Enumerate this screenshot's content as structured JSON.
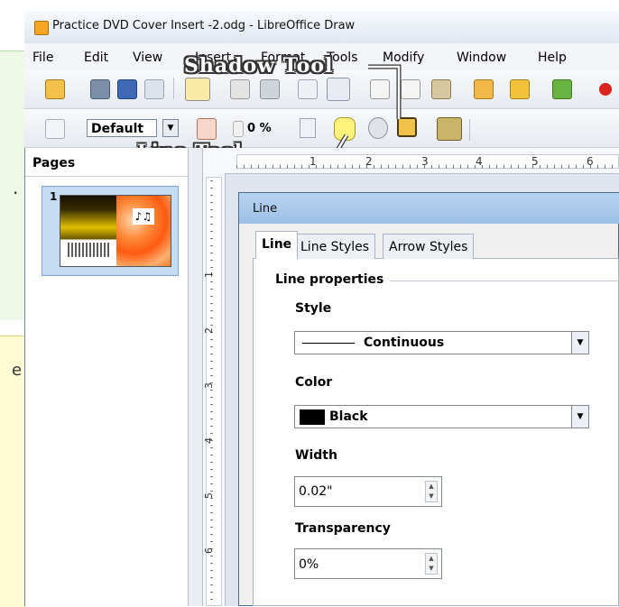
{
  "window": {
    "title": "Practice DVD Cover Insert -2.odg - LibreOffice Draw"
  },
  "menubar": {
    "items": [
      {
        "label": "File"
      },
      {
        "label": "Edit"
      },
      {
        "label": "View"
      },
      {
        "label": "Insert"
      },
      {
        "label": "Format"
      },
      {
        "label": "Tools"
      },
      {
        "label": "Modify"
      },
      {
        "label": "Window"
      },
      {
        "label": "Help"
      }
    ]
  },
  "toolbar2": {
    "style_value": "Default",
    "transparency_value": "0 %"
  },
  "callouts": {
    "shadow_tool": "Shadow Tool",
    "line_tool": "Line Tool"
  },
  "pages_pane": {
    "header": "Pages",
    "page_number": "1"
  },
  "ruler": {
    "h_ticks": [
      "1",
      "2",
      "3",
      "4",
      "5",
      "6"
    ],
    "v_ticks": [
      "1",
      "2",
      "3",
      "4",
      "5",
      "6"
    ]
  },
  "dialog": {
    "title": "Line",
    "tabs": [
      "Line",
      "Line Styles",
      "Arrow Styles"
    ],
    "section": "Line properties",
    "style_label": "Style",
    "style_value": "Continuous",
    "color_label": "Color",
    "color_value": "Black",
    "color_swatch": "#000000",
    "width_label": "Width",
    "width_value": "0.02\"",
    "transparency_label": "Transparency",
    "transparency_value": "0%"
  },
  "colors": {
    "accent": "#9ec0e6",
    "callout_text": "#ffffff"
  }
}
